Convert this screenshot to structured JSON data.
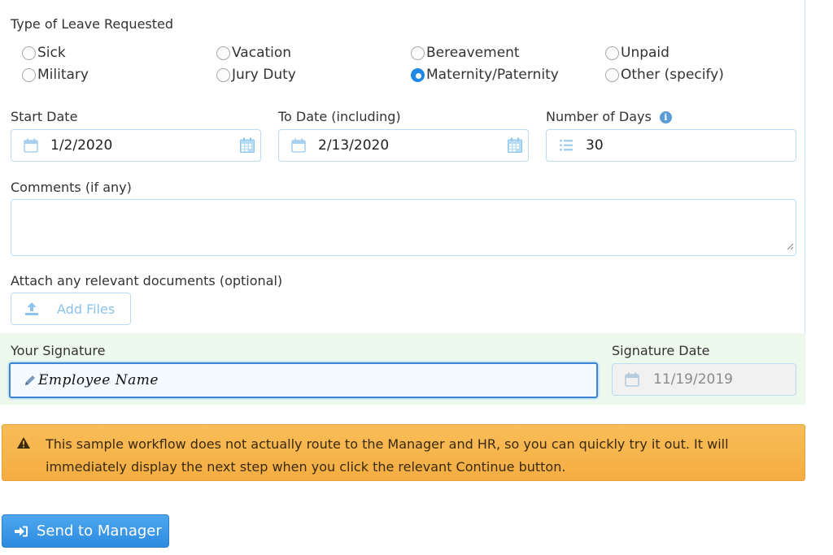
{
  "leave_type": {
    "label": "Type of Leave Requested",
    "options": [
      {
        "label": "Sick",
        "checked": false
      },
      {
        "label": "Vacation",
        "checked": false
      },
      {
        "label": "Bereavement",
        "checked": false
      },
      {
        "label": "Unpaid",
        "checked": false
      },
      {
        "label": "Military",
        "checked": false
      },
      {
        "label": "Jury Duty",
        "checked": false
      },
      {
        "label": "Maternity/Paternity",
        "checked": true
      },
      {
        "label": "Other (specify)",
        "checked": false
      }
    ]
  },
  "start_date": {
    "label": "Start Date",
    "value": "1/2/2020",
    "icon": "calendar-icon"
  },
  "to_date": {
    "label": "To Date (including)",
    "value": "2/13/2020",
    "icon": "calendar-icon"
  },
  "num_days": {
    "label": "Number of Days",
    "value": "30",
    "icon": "list-icon",
    "info_icon": "info-icon"
  },
  "comments": {
    "label": "Comments (if any)",
    "value": ""
  },
  "attach": {
    "label": "Attach any relevant documents (optional)",
    "button_label": "Add Files",
    "icon": "upload-icon"
  },
  "signature": {
    "label": "Your Signature",
    "value": "Employee Name",
    "icon": "pencil-icon"
  },
  "signature_date": {
    "label": "Signature Date",
    "value": "11/19/2019",
    "icon": "calendar-icon"
  },
  "alert": {
    "icon": "warning-icon",
    "message": "This sample workflow does not actually route to the Manager and HR, so you can quickly try it out. It will immediately display the next step when you click the relevant Continue button."
  },
  "send_button": {
    "label": "Send to Manager",
    "icon": "sign-in-icon"
  },
  "colors": {
    "accent": "#2c8ae0",
    "field_border": "#b9dcf3",
    "alert_bg": "#f7b54d",
    "signature_band": "#eef9ee"
  }
}
